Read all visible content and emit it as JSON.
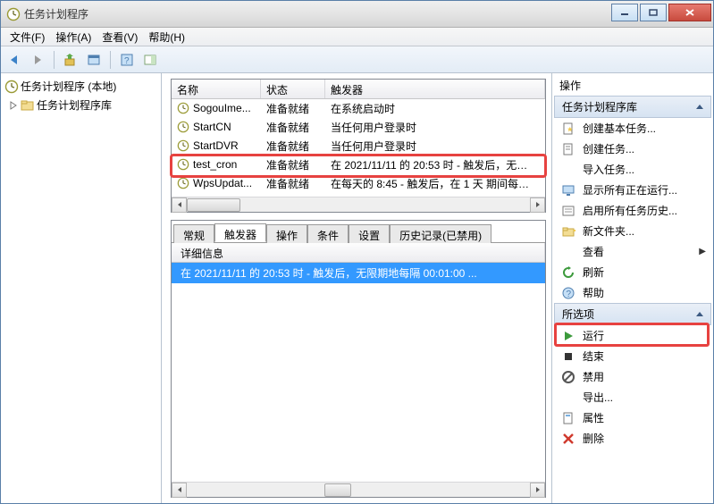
{
  "window_title": "任务计划程序",
  "menus": {
    "file": "文件(F)",
    "action": "操作(A)",
    "view": "查看(V)",
    "help": "帮助(H)"
  },
  "tree": {
    "root": "任务计划程序 (本地)",
    "child": "任务计划程序库"
  },
  "task_table": {
    "headers": {
      "name": "名称",
      "state": "状态",
      "trigger": "触发器"
    },
    "rows": [
      {
        "name": "SogouIme...",
        "state": "准备就绪",
        "trigger": "在系统启动时"
      },
      {
        "name": "StartCN",
        "state": "准备就绪",
        "trigger": "当任何用户登录时"
      },
      {
        "name": "StartDVR",
        "state": "准备就绪",
        "trigger": "当任何用户登录时"
      },
      {
        "name": "test_cron",
        "state": "准备就绪",
        "trigger": "在 2021/11/11 的 20:53 时 - 触发后，无…"
      },
      {
        "name": "WpsUpdat...",
        "state": "准备就绪",
        "trigger": "在每天的 8:45 - 触发后，在 1 天 期间每…"
      }
    ]
  },
  "tabs": {
    "labels": [
      "常规",
      "触发器",
      "操作",
      "条件",
      "设置",
      "历史记录(已禁用)"
    ],
    "active_index": 1,
    "detail_header": "详细信息",
    "detail_row": "在 2021/11/11 的 20:53 时 - 触发后，无限期地每隔 00:01:00 ..."
  },
  "actions_panel": {
    "title": "操作",
    "section_lib": "任务计划程序库",
    "section_sel": "所选项",
    "lib_items": [
      {
        "icon": "doc-star",
        "label": "创建基本任务..."
      },
      {
        "icon": "doc-new",
        "label": "创建任务..."
      },
      {
        "icon": "blank",
        "label": "导入任务..."
      },
      {
        "icon": "display",
        "label": "显示所有正在运行..."
      },
      {
        "icon": "history",
        "label": "启用所有任务历史..."
      },
      {
        "icon": "folder-new",
        "label": "新文件夹..."
      },
      {
        "icon": "blank",
        "label": "查看",
        "chev": true
      },
      {
        "icon": "refresh",
        "label": "刷新"
      },
      {
        "icon": "help",
        "label": "帮助"
      }
    ],
    "sel_items": [
      {
        "icon": "play",
        "label": "运行"
      },
      {
        "icon": "stop",
        "label": "结束"
      },
      {
        "icon": "disable",
        "label": "禁用"
      },
      {
        "icon": "blank",
        "label": "导出..."
      },
      {
        "icon": "props",
        "label": "属性"
      },
      {
        "icon": "delete",
        "label": "删除"
      }
    ]
  }
}
